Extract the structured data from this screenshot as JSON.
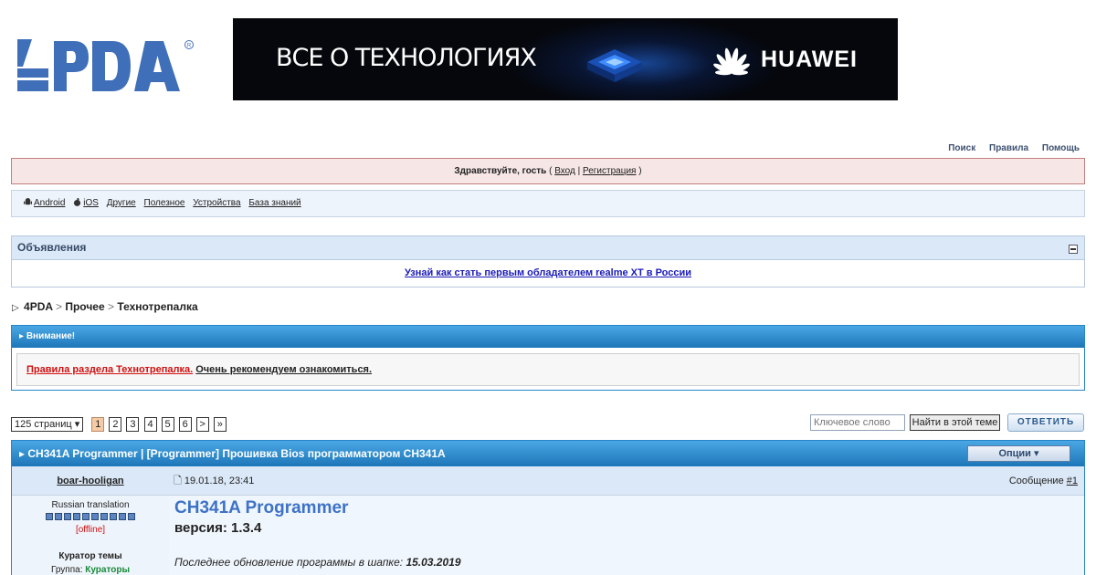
{
  "header": {
    "logo_text": "4PDA",
    "banner": {
      "tagline": "ВСЕ О ТЕХНОЛОГИЯХ",
      "brand": "HUAWEI"
    }
  },
  "toplinks": {
    "search": "Поиск",
    "rules": "Правила",
    "help": "Помощь"
  },
  "guestbar": {
    "greeting": "Здравствуйте, гость",
    "open_paren": " ( ",
    "login": "Вход",
    "divider": " | ",
    "register": "Регистрация",
    "close_paren": " )"
  },
  "catbar": {
    "items": [
      {
        "label": "Android",
        "icon": "android-icon"
      },
      {
        "label": "iOS",
        "icon": "apple-icon"
      },
      {
        "label": "Другие"
      },
      {
        "label": "Полезное"
      },
      {
        "label": "Устройства"
      },
      {
        "label": "База знаний"
      }
    ]
  },
  "announcements": {
    "title": "Объявления",
    "link": "Узнай как стать первым обладателем realme XT в России"
  },
  "breadcrumb": {
    "items": [
      "4PDA",
      "Прочее",
      "Технотрепалка"
    ],
    "separator": ">"
  },
  "notice": {
    "title": "Внимание!",
    "rules_link": "Правила раздела Технотрепалка.",
    "text": "Очень рекомендуем ознакомиться."
  },
  "pager": {
    "pages_label": "125 страниц",
    "pages": [
      "1",
      "2",
      "3",
      "4",
      "5",
      "6"
    ],
    "current": "1",
    "next": ">",
    "last": "»"
  },
  "search": {
    "placeholder": "Ключевое слово",
    "button": "Найти в этой теме",
    "reply": "ОТВЕТИТЬ"
  },
  "topic": {
    "title": "CH341A Programmer | [Programmer] Прошивка Bios программатором CH341A",
    "options": "Опции",
    "post": {
      "author": "boar-hooligan",
      "date": "19.01.18, 23:41",
      "message_label": "Сообщение ",
      "message_num": "#1",
      "rank": "Russian translation",
      "status": "[offline]",
      "curator": "Куратор темы",
      "group_label": "Группа: ",
      "group": "Кураторы",
      "content_title": "CH341A Programmer",
      "content_version": "версия: 1.3.4",
      "update_label": "Последнее обновление программы в шапке: ",
      "update_date": "15.03.2019"
    }
  },
  "colors": {
    "brand_blue": "#3f6fb8",
    "header_blue": "#2585c8",
    "guest_bg": "#f6e6e6",
    "link_red": "#d01010"
  }
}
